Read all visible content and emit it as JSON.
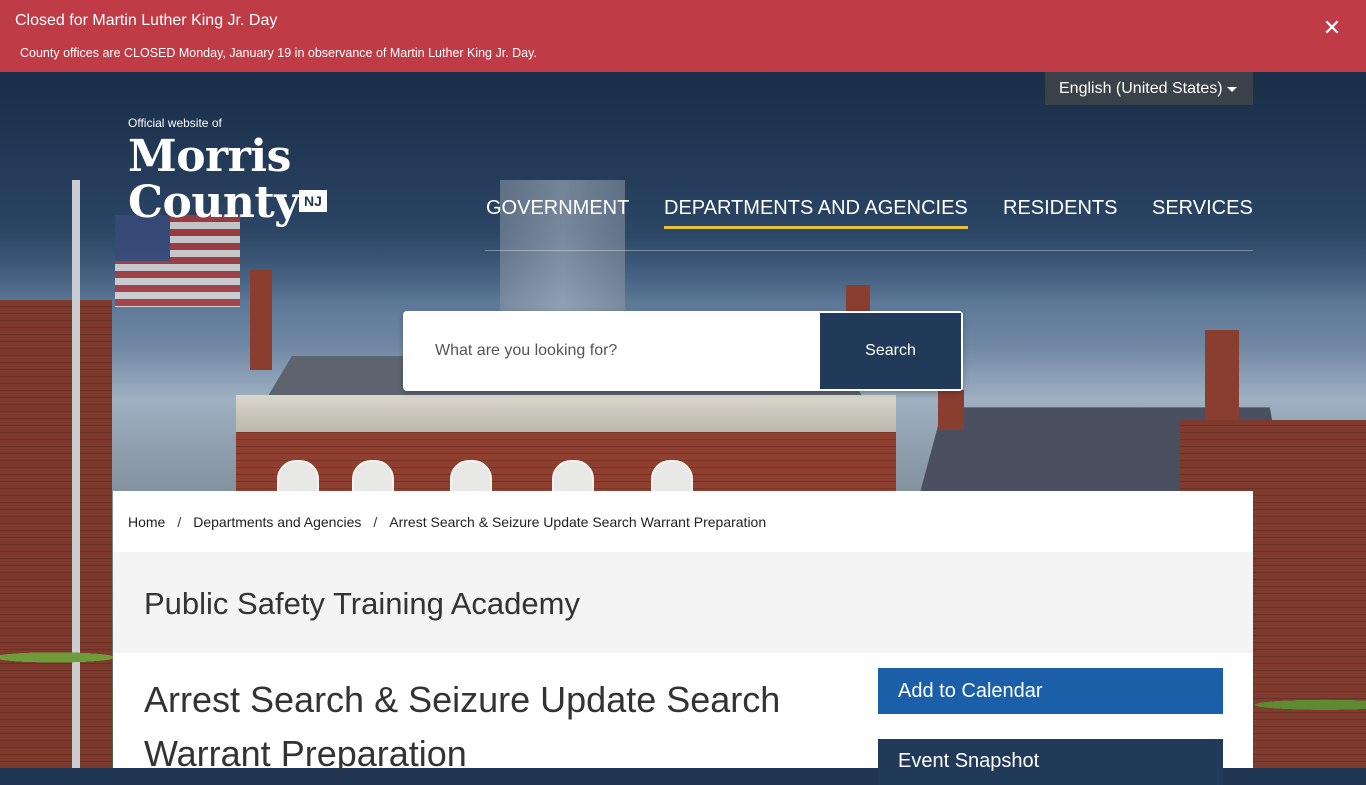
{
  "alert": {
    "title": "Closed for Martin Luther King Jr. Day",
    "message": "County offices are CLOSED Monday, January 19 in observance of Martin Luther King Jr. Day.",
    "close_icon": "close-icon",
    "background_color": "#bf3b46"
  },
  "language": {
    "selected": "English (United States)"
  },
  "logo": {
    "tagline": "Official website of",
    "line1": "Morris",
    "line2": "County",
    "badge": "NJ"
  },
  "nav": {
    "items": [
      {
        "label": "GOVERNMENT",
        "active": false
      },
      {
        "label": "DEPARTMENTS AND AGENCIES",
        "active": true
      },
      {
        "label": "RESIDENTS",
        "active": false
      },
      {
        "label": "SERVICES",
        "active": false
      }
    ],
    "active_underline_color": "#e7c23a"
  },
  "search": {
    "placeholder": "What are you looking for?",
    "button_label": "Search"
  },
  "breadcrumb": {
    "items": [
      "Home",
      "Departments and Agencies",
      "Arrest Search & Seizure Update Search Warrant Preparation"
    ],
    "separator": "/"
  },
  "section": {
    "title": "Public Safety Training Academy"
  },
  "event": {
    "title": "Arrest Search & Seizure Update Search Warrant Preparation",
    "add_to_calendar": "Add to Calendar",
    "snapshot": "Event Snapshot"
  },
  "colors": {
    "navy": "#213a5a",
    "accent_blue": "#1a5fa8"
  }
}
